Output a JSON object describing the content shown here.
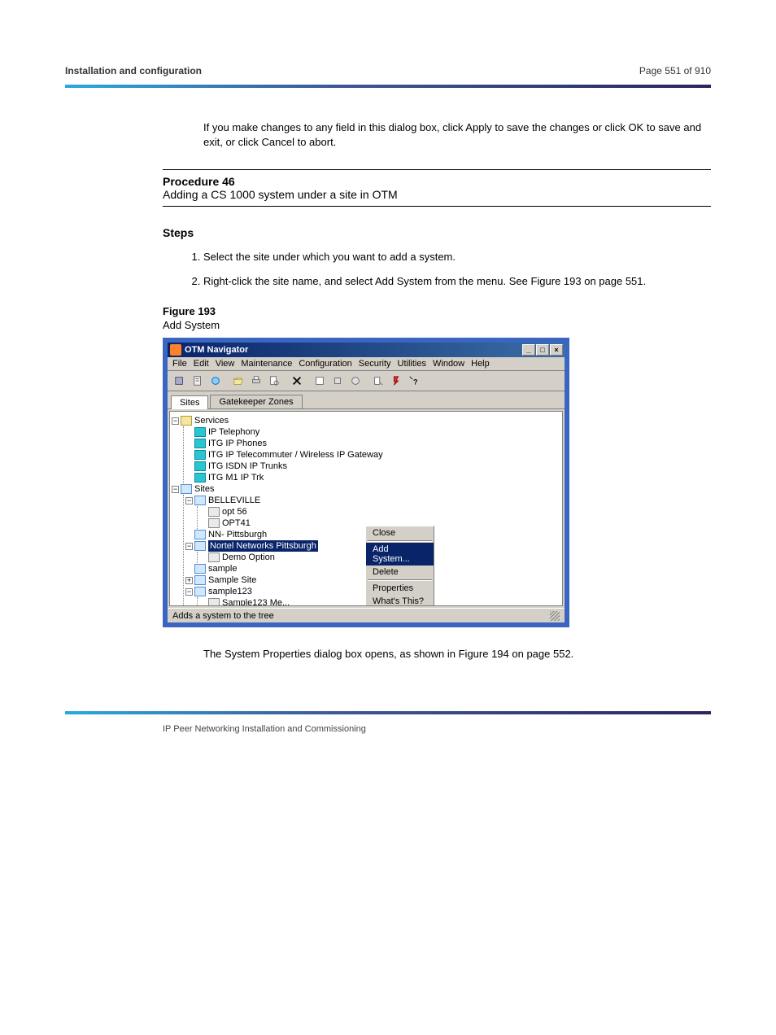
{
  "page_header": {
    "title": "Installation and configuration",
    "page_label": "Page 551 of 910"
  },
  "body": {
    "para1": "If you make changes to any field in this dialog box, click Apply to save the changes or click OK to save and exit, or click Cancel to abort.",
    "procedure": {
      "number": "Procedure 46",
      "title": "Adding a CS 1000 system under a site in OTM"
    },
    "steps": [
      "Select the site under which you want to add a system.",
      "Right-click the site name, and select Add System from the menu. See Figure 193 on page 551."
    ],
    "fig_num": "Figure 193",
    "fig_title": "Add System",
    "para_after": "The System Properties dialog box opens, as shown in Figure 194 on page 552.",
    "section_title": "Steps"
  },
  "footer": "IP Peer Networking  Installation and Commissioning",
  "window": {
    "title": "OTM Navigator",
    "menus": [
      "File",
      "Edit",
      "View",
      "Maintenance",
      "Configuration",
      "Security",
      "Utilities",
      "Window",
      "Help"
    ],
    "tabs": {
      "active": "Sites",
      "other": "Gatekeeper Zones"
    },
    "win_btns": {
      "min": "_",
      "max": "□",
      "close": "×"
    },
    "tree": {
      "services_label": "Services",
      "services": [
        "IP Telephony",
        "ITG IP Phones",
        "ITG IP Telecommuter / Wireless IP Gateway",
        "ITG ISDN IP Trunks",
        "ITG M1 IP Trk"
      ],
      "sites_label": "Sites",
      "sites": [
        {
          "name": "BELLEVILLE",
          "children": [
            "opt 56",
            "OPT41"
          ],
          "expanded": true
        },
        {
          "name": "NN- Pittsburgh",
          "children": [],
          "expanded": false
        },
        {
          "name": "Nortel Networks Pittsburgh",
          "children": [
            "Demo Option"
          ],
          "expanded": true,
          "selected": true
        },
        {
          "name": "sample",
          "children": [],
          "expanded": false
        },
        {
          "name": "Sample Site",
          "children": [],
          "expanded": false,
          "plus": true
        },
        {
          "name": "sample123",
          "children": [
            "Sample123 Me..."
          ],
          "expanded": true
        }
      ]
    },
    "context_menu": [
      "Close",
      "Add System...",
      "Delete",
      "Properties",
      "What's This?"
    ],
    "context_selected": "Add System...",
    "statusbar": "Adds a system to the tree"
  }
}
